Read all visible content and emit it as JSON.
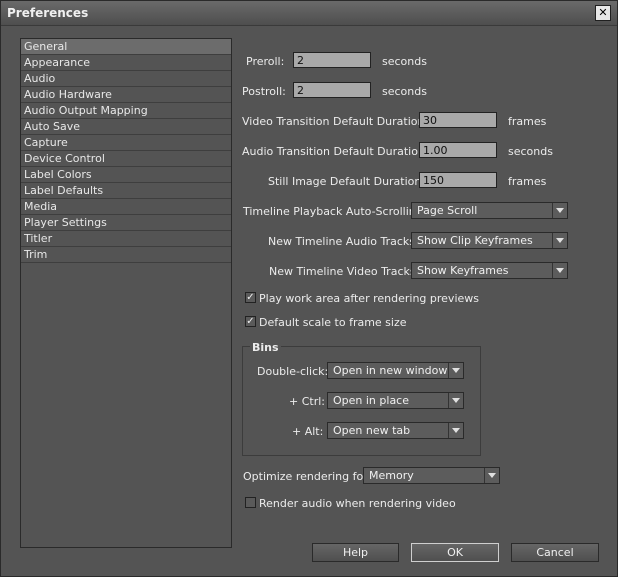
{
  "window": {
    "title": "Preferences"
  },
  "sidebar": {
    "items": [
      {
        "label": "General",
        "selected": true
      },
      {
        "label": "Appearance"
      },
      {
        "label": "Audio"
      },
      {
        "label": "Audio Hardware"
      },
      {
        "label": "Audio Output Mapping"
      },
      {
        "label": "Auto Save"
      },
      {
        "label": "Capture"
      },
      {
        "label": "Device Control"
      },
      {
        "label": "Label Colors"
      },
      {
        "label": "Label Defaults"
      },
      {
        "label": "Media"
      },
      {
        "label": "Player Settings"
      },
      {
        "label": "Titler"
      },
      {
        "label": "Trim"
      }
    ]
  },
  "general": {
    "preroll": {
      "label": "Preroll:",
      "value": "2",
      "unit": "seconds"
    },
    "postroll": {
      "label": "Postroll:",
      "value": "2",
      "unit": "seconds"
    },
    "video_transition": {
      "label": "Video Transition Default Duration:",
      "value": "30",
      "unit": "frames"
    },
    "audio_transition": {
      "label": "Audio Transition Default Duration:",
      "value": "1.00",
      "unit": "seconds"
    },
    "still_image": {
      "label": "Still Image Default Duration:",
      "value": "150",
      "unit": "frames"
    },
    "autoscroll": {
      "label": "Timeline Playback Auto-Scrolling:",
      "value": "Page Scroll"
    },
    "audio_tracks": {
      "label": "New Timeline Audio Tracks:",
      "value": "Show Clip Keyframes"
    },
    "video_tracks": {
      "label": "New Timeline Video Tracks:",
      "value": "Show Keyframes"
    },
    "play_work_area": {
      "label": "Play work area after rendering previews",
      "checked": true
    },
    "default_scale": {
      "label": "Default scale to frame size",
      "checked": true
    },
    "bins": {
      "title": "Bins",
      "double_click": {
        "label": "Double-click:",
        "value": "Open in new window"
      },
      "ctrl": {
        "label": "+ Ctrl:",
        "value": "Open in place"
      },
      "alt": {
        "label": "+ Alt:",
        "value": "Open new tab"
      }
    },
    "optimize": {
      "label": "Optimize rendering for:",
      "value": "Memory"
    },
    "render_audio": {
      "label": "Render audio when rendering video",
      "checked": false
    }
  },
  "buttons": {
    "help": "Help",
    "ok": "OK",
    "cancel": "Cancel"
  }
}
